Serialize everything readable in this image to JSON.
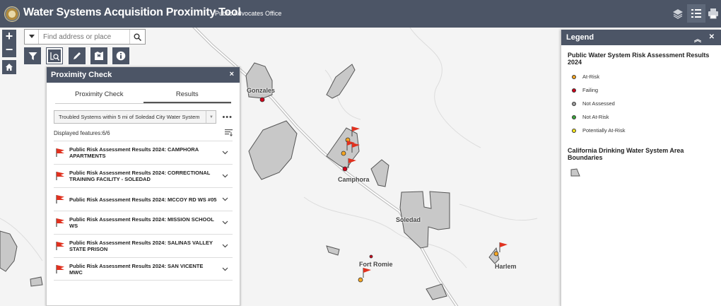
{
  "header": {
    "title": "Water Systems Acquisition Proximity Tool",
    "subtitle": "Public Advocates Office",
    "buttons": [
      {
        "icon": "layers-icon"
      },
      {
        "icon": "legend-list-icon",
        "active": true
      },
      {
        "icon": "print-icon"
      }
    ]
  },
  "map": {
    "zoom_in": "+",
    "zoom_out": "−",
    "home_icon": "home-icon",
    "search": {
      "placeholder": "Find address or place"
    },
    "tools": [
      {
        "icon": "filter-icon"
      },
      {
        "icon": "proximity-icon",
        "active": true
      },
      {
        "icon": "draw-pencil-icon"
      },
      {
        "icon": "map-bookmark-icon"
      },
      {
        "icon": "info-icon"
      }
    ],
    "places": {
      "gonzales": "Gonzales",
      "camphora": "Camphora",
      "soledad": "Soledad",
      "fort_romie": "Fort Romie",
      "harlem": "Harlem"
    }
  },
  "panel": {
    "title": "Proximity Check",
    "close": "×",
    "tabs": [
      "Proximity Check",
      "Results"
    ],
    "active_tab": 1,
    "filter_value": "Troubled Systems within 5 mi of Soledad City Water System",
    "more": "•••",
    "count_text": "Displayed features:6/6",
    "results": [
      {
        "label": "Public Risk Assessment Results 2024: CAMPHORA APARTMENTS"
      },
      {
        "label": "Public Risk Assessment Results 2024: CORRECTIONAL TRAINING FACILITY - SOLEDAD"
      },
      {
        "label": "Public Risk Assessment Results 2024: MCCOY RD WS #05"
      },
      {
        "label": "Public Risk Assessment Results 2024: MISSION SCHOOL WS"
      },
      {
        "label": "Public Risk Assessment Results 2024: SALINAS VALLEY STATE PRISON"
      },
      {
        "label": "Public Risk Assessment Results 2024: SAN VICENTE MWC"
      }
    ]
  },
  "legend": {
    "title": "Legend",
    "group1_title": "Public Water System Risk Assessment Results 2024",
    "items": [
      {
        "label": "At-Risk",
        "color": "#f5a623"
      },
      {
        "label": "Failing",
        "color": "#d0021b"
      },
      {
        "label": "Not Assessed",
        "color": "#9b9b9b"
      },
      {
        "label": "Not At-Risk",
        "color": "#3aa53a"
      },
      {
        "label": "Potentially At-Risk",
        "color": "#f8e71c"
      }
    ],
    "group2_title": "California Drinking Water System Area Boundaries"
  },
  "colors": {
    "header_bg": "#4c5566",
    "flag_red": "#e0311f",
    "area_fill": "#c8c8c8"
  }
}
